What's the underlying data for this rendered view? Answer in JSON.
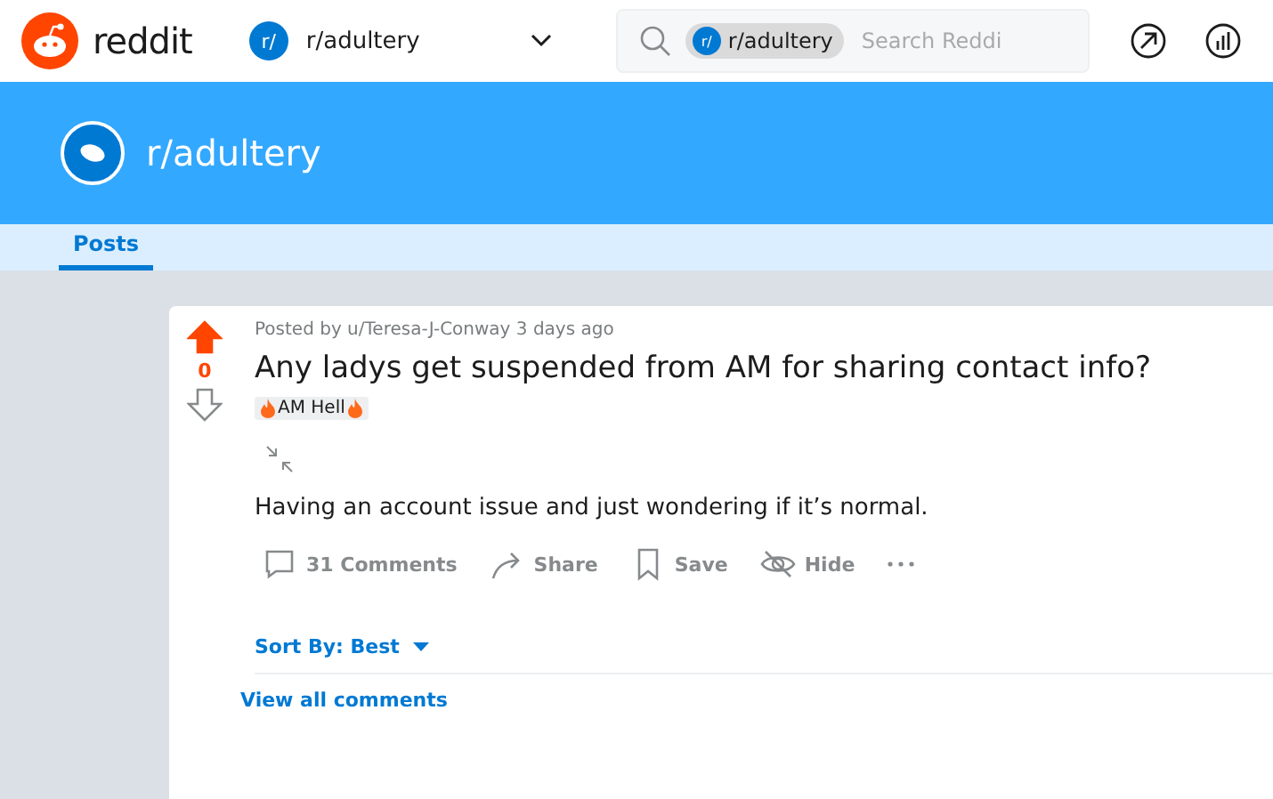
{
  "header": {
    "logo": "reddit",
    "community": {
      "badge": "r/",
      "name": "r/adultery"
    },
    "search": {
      "chip_badge": "r/",
      "chip": "r/adultery",
      "placeholder": "Search Reddi"
    }
  },
  "banner": {
    "title": "r/adultery"
  },
  "tabs": [
    {
      "label": "Posts",
      "selected": true
    }
  ],
  "post": {
    "upvoted": true,
    "score": "0",
    "meta": "Posted by u/Teresa-J-Conway 3 days ago",
    "title": "Any ladys get suspended from AM for sharing contact info?",
    "flair": "AM Hell",
    "body": "Having an account issue and just wondering if it’s normal.",
    "actions": [
      {
        "kind": "comment",
        "label": "31 Comments"
      },
      {
        "kind": "share",
        "label": "Share"
      },
      {
        "kind": "save",
        "label": "Save"
      },
      {
        "kind": "hide",
        "label": "Hide"
      },
      {
        "kind": "more"
      }
    ]
  },
  "sort": {
    "label": "Sort By: Best"
  },
  "view_all": "View all comments"
}
